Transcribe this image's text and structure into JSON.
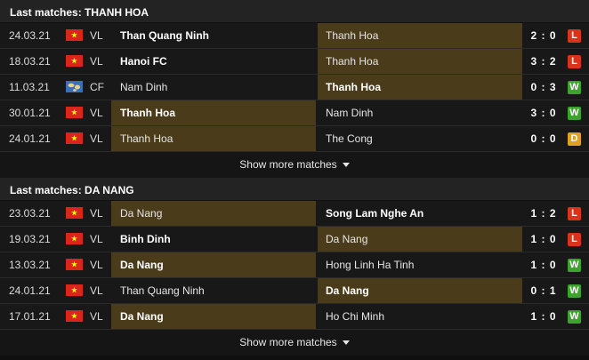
{
  "colors": {
    "win": "#3fa12f",
    "loss": "#d9341b",
    "draw": "#e0a020",
    "highlight": "#4a3c1b"
  },
  "sections": [
    {
      "title": "Last matches: THANH HOA",
      "show_more": "Show more matches",
      "matches": [
        {
          "date": "24.03.21",
          "flag": "vietnam-flag",
          "comp": "VL",
          "home": "Than Quang Ninh",
          "away": "Thanh Hoa",
          "score": "2 : 0",
          "result": "L",
          "home_bold": true,
          "away_bold": false,
          "highlight": "away"
        },
        {
          "date": "18.03.21",
          "flag": "vietnam-flag",
          "comp": "VL",
          "home": "Hanoi FC",
          "away": "Thanh Hoa",
          "score": "3 : 2",
          "result": "L",
          "home_bold": true,
          "away_bold": false,
          "highlight": "away"
        },
        {
          "date": "11.03.21",
          "flag": "world-flag",
          "comp": "CF",
          "home": "Nam Dinh",
          "away": "Thanh Hoa",
          "score": "0 : 3",
          "result": "W",
          "home_bold": false,
          "away_bold": true,
          "highlight": "away"
        },
        {
          "date": "30.01.21",
          "flag": "vietnam-flag",
          "comp": "VL",
          "home": "Thanh Hoa",
          "away": "Nam Dinh",
          "score": "3 : 0",
          "result": "W",
          "home_bold": true,
          "away_bold": false,
          "highlight": "home"
        },
        {
          "date": "24.01.21",
          "flag": "vietnam-flag",
          "comp": "VL",
          "home": "Thanh Hoa",
          "away": "The Cong",
          "score": "0 : 0",
          "result": "D",
          "home_bold": false,
          "away_bold": false,
          "highlight": "home"
        }
      ]
    },
    {
      "title": "Last matches: DA NANG",
      "show_more": "Show more matches",
      "matches": [
        {
          "date": "23.03.21",
          "flag": "vietnam-flag",
          "comp": "VL",
          "home": "Da Nang",
          "away": "Song Lam Nghe An",
          "score": "1 : 2",
          "result": "L",
          "home_bold": false,
          "away_bold": true,
          "highlight": "home"
        },
        {
          "date": "19.03.21",
          "flag": "vietnam-flag",
          "comp": "VL",
          "home": "Binh Dinh",
          "away": "Da Nang",
          "score": "1 : 0",
          "result": "L",
          "home_bold": true,
          "away_bold": false,
          "highlight": "away"
        },
        {
          "date": "13.03.21",
          "flag": "vietnam-flag",
          "comp": "VL",
          "home": "Da Nang",
          "away": "Hong Linh Ha Tinh",
          "score": "1 : 0",
          "result": "W",
          "home_bold": true,
          "away_bold": false,
          "highlight": "home"
        },
        {
          "date": "24.01.21",
          "flag": "vietnam-flag",
          "comp": "VL",
          "home": "Than Quang Ninh",
          "away": "Da Nang",
          "score": "0 : 1",
          "result": "W",
          "home_bold": false,
          "away_bold": true,
          "highlight": "away"
        },
        {
          "date": "17.01.21",
          "flag": "vietnam-flag",
          "comp": "VL",
          "home": "Da Nang",
          "away": "Ho Chi Minh",
          "score": "1 : 0",
          "result": "W",
          "home_bold": true,
          "away_bold": false,
          "highlight": "home"
        }
      ]
    }
  ]
}
